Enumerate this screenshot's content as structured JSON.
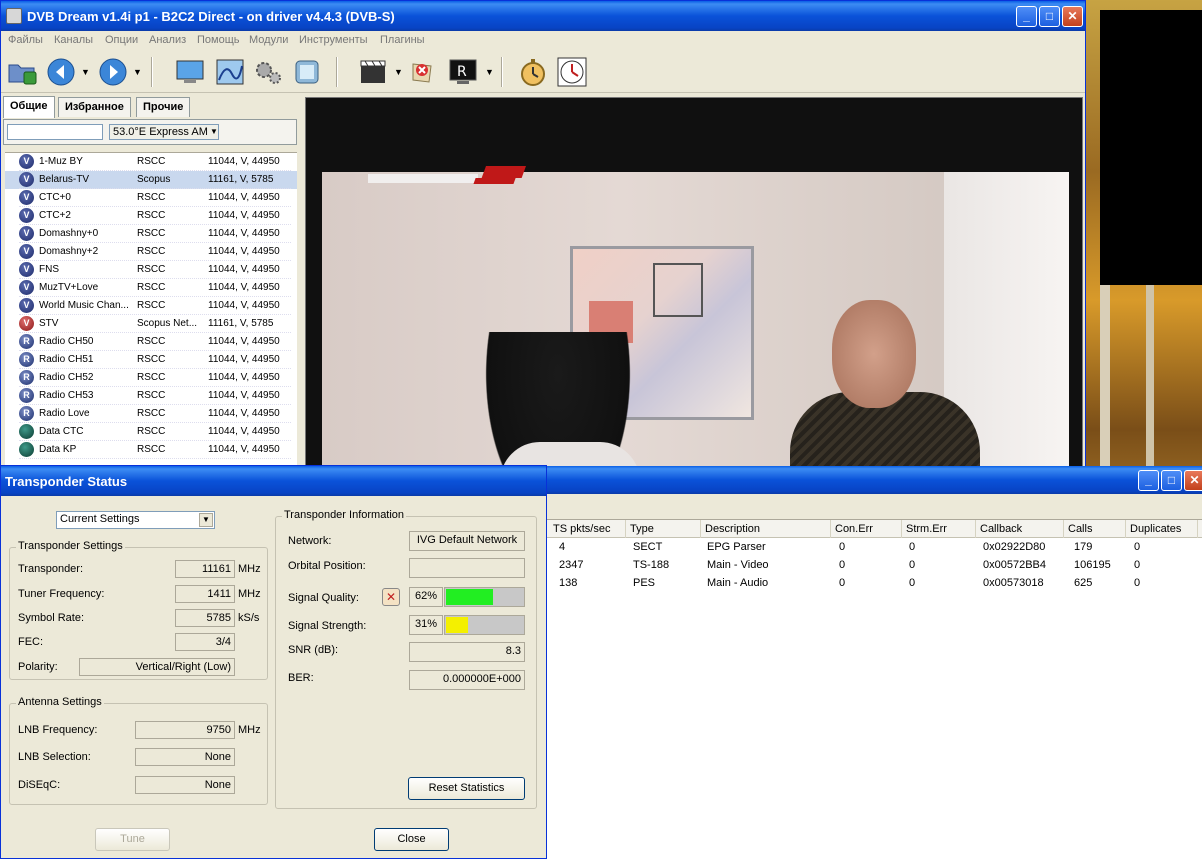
{
  "main_window": {
    "title": "DVB Dream v1.4i p1 - B2C2 Direct - on driver v4.4.3 (DVB-S)",
    "menu": [
      "Файлы",
      "Каналы",
      "Опции",
      "Анализ",
      "Помощь",
      "Модули",
      "Инструменты",
      "Плагины"
    ],
    "toolbar_icons": [
      "open-folder-icon",
      "back-icon",
      "forward-icon",
      "tv-screen-icon",
      "spectrum-icon",
      "settings-gears-icon",
      "snapshot-icon",
      "clapperboard-icon",
      "delete-icon",
      "record-icon",
      "stopwatch-icon",
      "clock-icon"
    ]
  },
  "channel_panel": {
    "tabs": [
      "Общие",
      "Избранное",
      "Прочие"
    ],
    "filter_value": "",
    "satellite": "53.0°E Express AM",
    "channels": [
      {
        "icon": "v",
        "name": "1-Muz BY",
        "provider": "RSCC",
        "transponder": "11044, V, 44950"
      },
      {
        "icon": "v",
        "name": "Belarus-TV",
        "provider": "Scopus",
        "transponder": "11161, V, 5785"
      },
      {
        "icon": "v",
        "name": "CTC+0",
        "provider": "RSCC",
        "transponder": "11044, V, 44950"
      },
      {
        "icon": "v",
        "name": "CTC+2",
        "provider": "RSCC",
        "transponder": "11044, V, 44950"
      },
      {
        "icon": "v",
        "name": "Domashny+0",
        "provider": "RSCC",
        "transponder": "11044, V, 44950"
      },
      {
        "icon": "v",
        "name": "Domashny+2",
        "provider": "RSCC",
        "transponder": "11044, V, 44950"
      },
      {
        "icon": "v",
        "name": "FNS",
        "provider": "RSCC",
        "transponder": "11044, V, 44950"
      },
      {
        "icon": "v",
        "name": "MuzTV+Love",
        "provider": "RSCC",
        "transponder": "11044, V, 44950"
      },
      {
        "icon": "v",
        "name": "World Music Chan...",
        "provider": "RSCC",
        "transponder": "11044, V, 44950"
      },
      {
        "icon": "vr",
        "name": "STV",
        "provider": "Scopus Net...",
        "transponder": "11161, V, 5785"
      },
      {
        "icon": "r",
        "name": "Radio CH50",
        "provider": "RSCC",
        "transponder": "11044, V, 44950"
      },
      {
        "icon": "r",
        "name": "Radio CH51",
        "provider": "RSCC",
        "transponder": "11044, V, 44950"
      },
      {
        "icon": "r",
        "name": "Radio CH52",
        "provider": "RSCC",
        "transponder": "11044, V, 44950"
      },
      {
        "icon": "r",
        "name": "Radio CH53",
        "provider": "RSCC",
        "transponder": "11044, V, 44950"
      },
      {
        "icon": "r",
        "name": "Radio Love",
        "provider": "RSCC",
        "transponder": "11044, V, 44950"
      },
      {
        "icon": "d",
        "name": "Data CTC",
        "provider": "RSCC",
        "transponder": "11044, V, 44950"
      },
      {
        "icon": "d",
        "name": "Data KP",
        "provider": "RSCC",
        "transponder": "11044, V, 44950"
      }
    ],
    "selected_index": 1
  },
  "stats_window": {
    "columns": [
      "TS pkts/sec",
      "Type",
      "Description",
      "Con.Err",
      "Strm.Err",
      "Callback",
      "Calls",
      "Duplicates"
    ],
    "rows": [
      [
        "4",
        "SECT",
        "EPG Parser",
        "0",
        "0",
        "0x02922D80",
        "179",
        "0"
      ],
      [
        "2347",
        "TS-188",
        "Main - Video",
        "0",
        "0",
        "0x00572BB4",
        "106195",
        "0"
      ],
      [
        "138",
        "PES",
        "Main - Audio",
        "0",
        "0",
        "0x00573018",
        "625",
        "0"
      ]
    ]
  },
  "transponder_dialog": {
    "title": "Transponder Status",
    "settings_combo": "Current Settings",
    "transponder_settings": {
      "group_label": "Transponder Settings",
      "transponder_label": "Transponder:",
      "transponder_value": "11161",
      "transponder_unit": "MHz",
      "tuner_label": "Tuner Frequency:",
      "tuner_value": "1411",
      "tuner_unit": "MHz",
      "symbol_label": "Symbol Rate:",
      "symbol_value": "5785",
      "symbol_unit": "kS/s",
      "fec_label": "FEC:",
      "fec_value": "3/4",
      "polarity_label": "Polarity:",
      "polarity_value": "Vertical/Right (Low)"
    },
    "antenna_settings": {
      "group_label": "Antenna Settings",
      "lnb_freq_label": "LNB Frequency:",
      "lnb_freq_value": "9750",
      "lnb_freq_unit": "MHz",
      "lnb_sel_label": "LNB Selection:",
      "lnb_sel_value": "None",
      "diseqc_label": "DiSEqC:",
      "diseqc_value": "None"
    },
    "transponder_info": {
      "group_label": "Transponder Information",
      "network_label": "Network:",
      "network_value": "IVG Default Network",
      "orbital_label": "Orbital Position:",
      "orbital_value": "",
      "quality_label": "Signal Quality:",
      "quality_value": "62%",
      "quality_fraction": 0.62,
      "quality_color": "#22ee22",
      "strength_label": "Signal Strength:",
      "strength_value": "31%",
      "strength_fraction": 0.31,
      "strength_color": "#f4f000",
      "snr_label": "SNR (dB):",
      "snr_value": "8.3",
      "ber_label": "BER:",
      "ber_value": "0.000000E+000",
      "reset_button": "Reset Statistics"
    },
    "tune_button": "Tune",
    "close_button": "Close"
  }
}
